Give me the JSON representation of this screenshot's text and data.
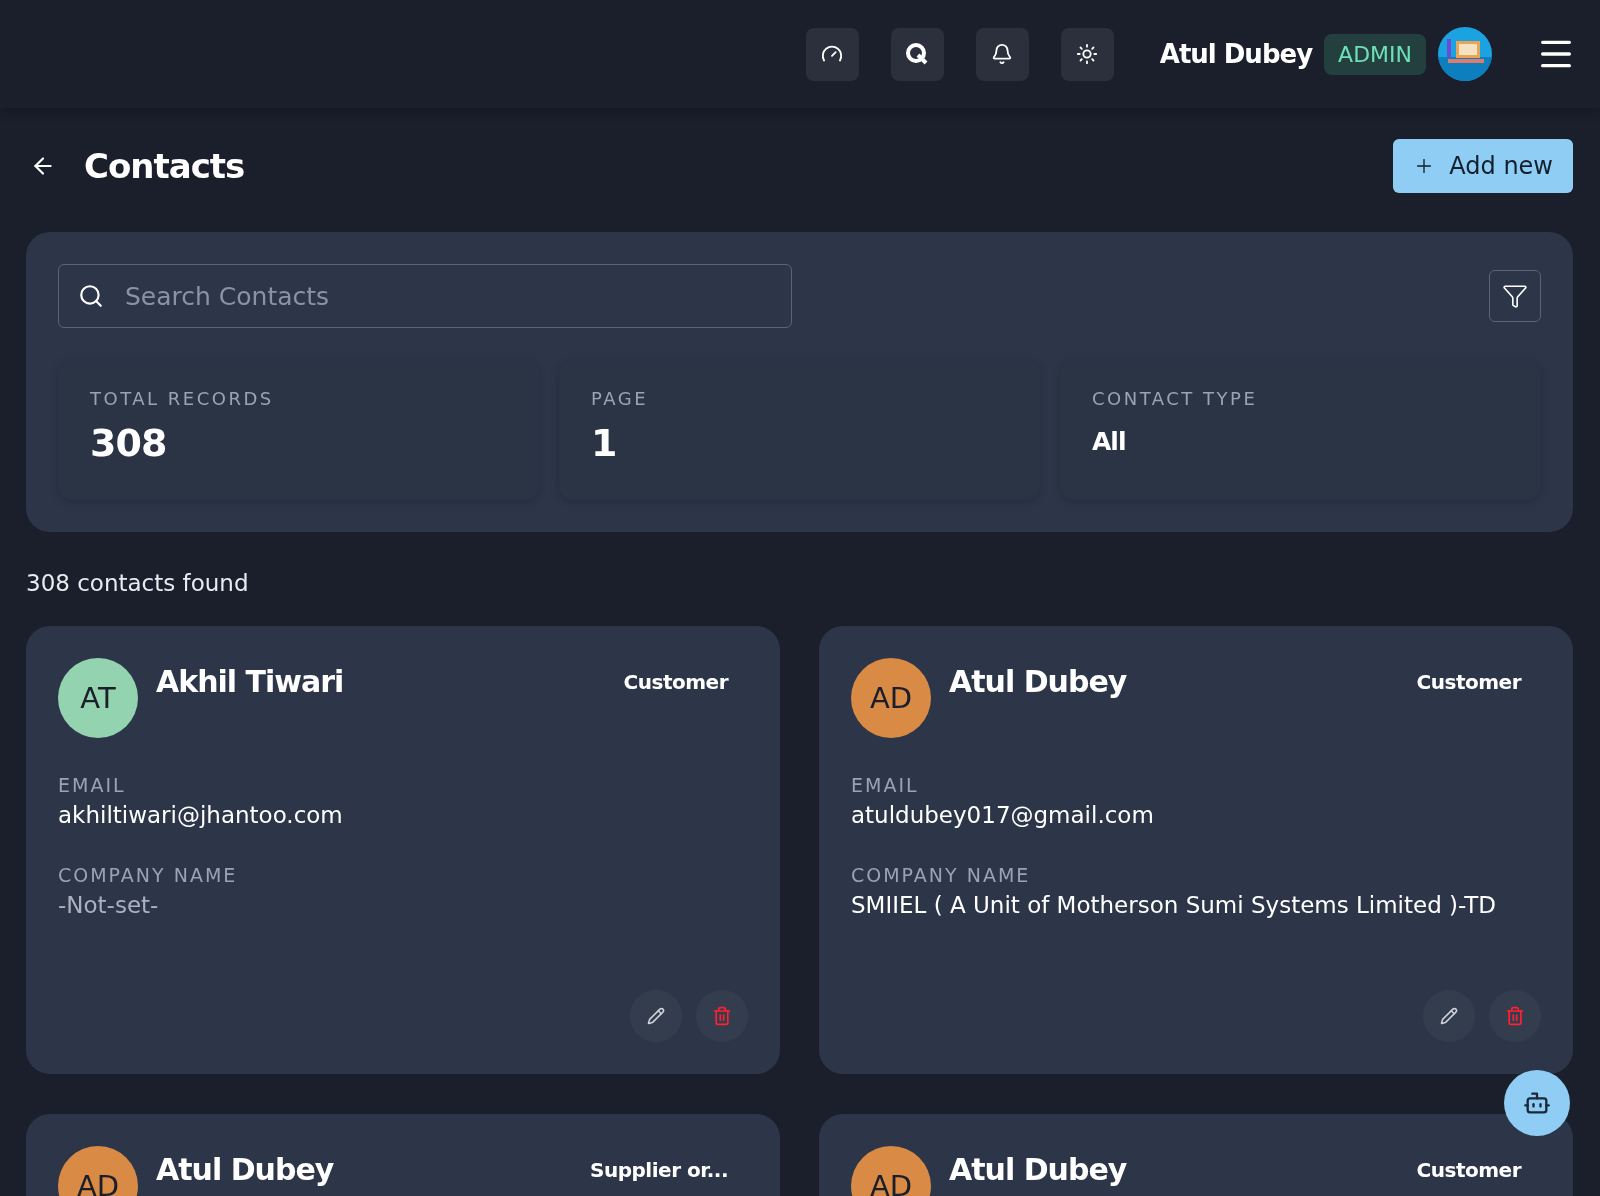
{
  "header": {
    "user_name": "Atul Dubey",
    "role": "ADMIN"
  },
  "page": {
    "title": "Contacts",
    "add_button": "Add new"
  },
  "search": {
    "placeholder": "Search Contacts"
  },
  "stats": [
    {
      "label": "TOTAL RECORDS",
      "value": "308",
      "kind": "big"
    },
    {
      "label": "PAGE",
      "value": "1",
      "kind": "big"
    },
    {
      "label": "CONTACT TYPE",
      "value": "All",
      "kind": "small"
    }
  ],
  "result_count": "308 contacts found",
  "contacts": [
    {
      "initials": "AT",
      "color": "#94d3b0",
      "name": "Akhil Tiwari",
      "type": "Customer",
      "email_label": "EMAIL",
      "email": "akhiltiwari@jhantoo.com",
      "company_label": "COMPANY NAME",
      "company": "-Not-set-",
      "company_set": false
    },
    {
      "initials": "AD",
      "color": "#d98b45",
      "name": "Atul Dubey",
      "type": "Customer",
      "email_label": "EMAIL",
      "email": "atuldubey017@gmail.com",
      "company_label": "COMPANY NAME",
      "company": "SMIIEL ( A Unit of Motherson Sumi Systems Limited )-TD",
      "company_set": true
    },
    {
      "initials": "AD",
      "color": "#d98b45",
      "name": "Atul Dubey",
      "type": "Supplier or..."
    },
    {
      "initials": "AD",
      "color": "#d98b45",
      "name": "Atul Dubey",
      "type": "Customer"
    }
  ]
}
